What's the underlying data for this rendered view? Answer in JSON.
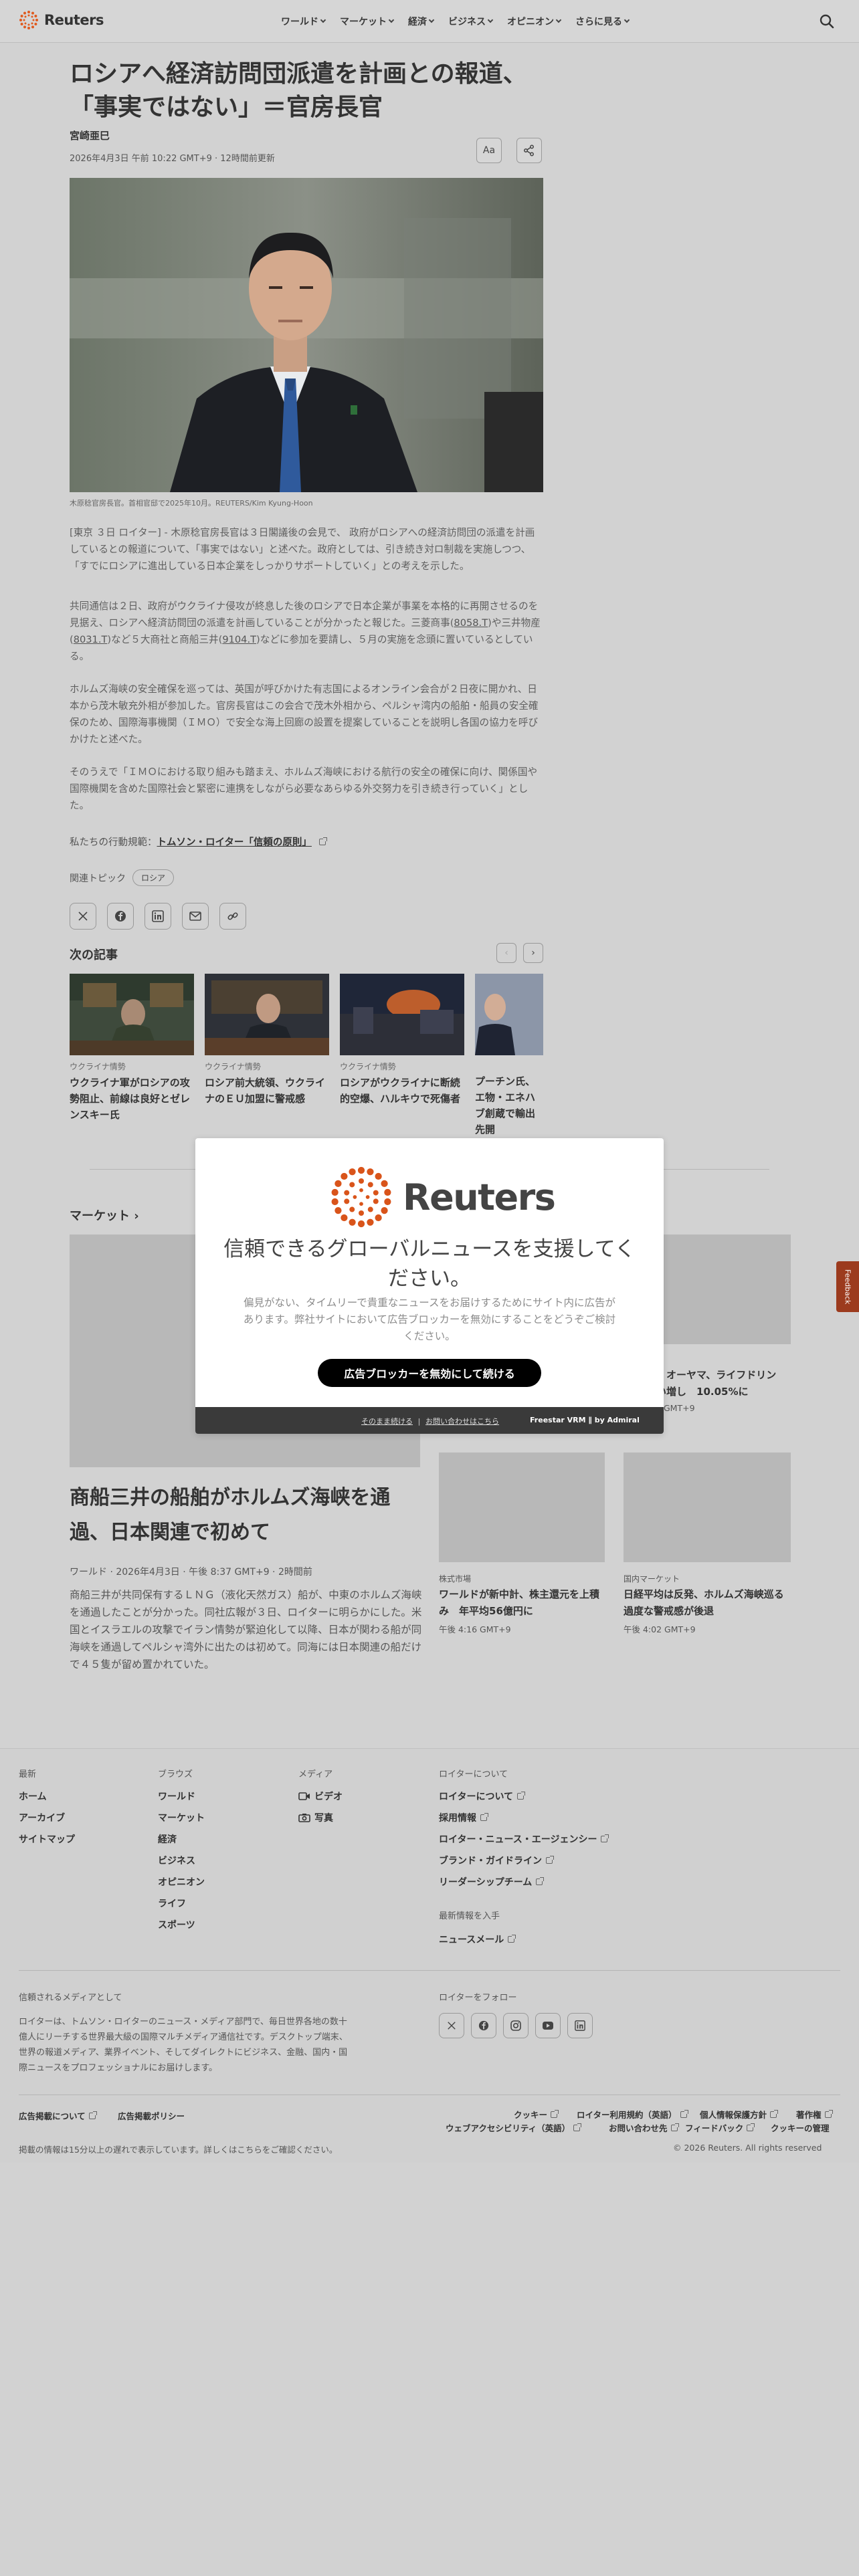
{
  "header": {
    "logo_text": "Reuters",
    "nav": [
      "ワールド",
      "マーケット",
      "経済",
      "ビジネス",
      "オピニオン",
      "さらに見る"
    ]
  },
  "article": {
    "headline": "ロシアへ経済訪問団派遣を計画との報道、「事実ではない」＝官房長官",
    "author": "宮崎亜巳",
    "dateline": "2026年4月3日 午前 10:22 GMT+9 · 12時間前更新",
    "font_button": "Aa",
    "caption": "木原稔官房長官。首相官邸で2025年10月。REUTERS/Kim Kyung-Hoon",
    "p1": "[東京 ３日 ロイター] - 木原稔官房長官は３日閣議後の会見で、 政府がロシアへの経済訪問団の派遣を計画しているとの報道について、「事実ではない」と述べた。政府としては、引き続き対ロ制裁を実施しつつ、「すでにロシアに進出している日本企業をしっかりサポートしていく」との考えを示した。",
    "p2_a": "共同通信は２日、政府がウクライナ侵攻が終息した後のロシアで日本企業が事業を本格的に再開させるのを見据え、ロシアへ経済訪問団の派遣を計画していることが分かったと報じた。三菱商事(",
    "p2_t1": "8058.T",
    "p2_b": ")や三井物産(",
    "p2_t2": "8031.T",
    "p2_c": ")など５大商社と商船三井(",
    "p2_t3": "9104.T",
    "p2_d": ")などに参加を要請し、５月の実施を念頭に置いているとしている。",
    "p3": "ホルムズ海峡の安全確保を巡っては、英国が呼びかけた有志国によるオンライン会合が２日夜に開かれ、日本から茂木敏充外相が参加した。官房長官はこの会合で茂木外相から、ペルシャ湾内の船舶・船員の安全確保のため、国際海事機関（ＩＭＯ）で安全な海上回廊の設置を提案していることを説明し各国の協力を呼びかけたと述べた。",
    "p4": "そのうえで「ＩＭＯにおける取り組みも踏まえ、ホルムズ海峡における航行の安全の確保に向け、関係国や国際機関を含めた国際社会と緊密に連携をしながら必要なあらゆる外交努力を引き続き行っていく」とした。",
    "principles_label": "私たちの行動規範：",
    "principles_link": "トムソン・ロイター「信頼の原則」",
    "topics_label": "関連トピック",
    "topic_pill": "ロシア"
  },
  "next": {
    "title": "次の記事",
    "cards": [
      {
        "kicker": "ウクライナ情勢",
        "title": "ウクライナ軍がロシアの攻勢阻止、前線は良好とゼレンスキー氏"
      },
      {
        "kicker": "ウクライナ情勢",
        "title": "ロシア前大統領、ウクライナのＥＵ加盟に警戒感"
      },
      {
        "kicker": "ウクライナ情勢",
        "title": "ロシアがウクライナに断続的空爆、ハルキウで死傷者"
      },
      {
        "kicker": "",
        "title": "プーチン氏、エ物・エネハブ創蔵で輸出先開"
      }
    ]
  },
  "market": {
    "title": "マーケット",
    "big_headline": "商船三井の船舶がホルムズ海峡を通過、日本関連で初めて",
    "big_meta": "ワールド · 2026年4月3日 · 午後 8:37 GMT+9 · 2時間前",
    "big_body": "商船三井が共同保有するＬＮＧ（液化天然ガス）船が、中東のホルムズ海峡を通過したことが分かった。同社広報が３日、ロイターに明らかにした。米国とイスラエルの攻撃でイラン情勢が緊迫化して以降、日本が関わる船が同海峡を通過してペルシャ湾外に出たのは初めて。同海には日本関連の船だけで４５隻が留め置かれていた。",
    "side_partial_title_1": "ニ、オーヤマ、ライフドリン",
    "side_partial_title_2": "買い増し　10.05%に",
    "side_partial_time": "GMT+9",
    "small": [
      {
        "kicker": "株式市場",
        "title": "ワールドが新中計、株主還元を上積み　年平均56億円に",
        "time": "午後 4:16 GMT+9"
      },
      {
        "kicker": "国内マーケット",
        "title": "日経平均は反発、ホルムズ海峡巡る過度な警戒感が後退",
        "time": "午後 4:02 GMT+9"
      }
    ]
  },
  "feedback": "Feedback",
  "modal": {
    "logo_text": "Reuters",
    "title": "信頼できるグローバルニュースを支援してください。",
    "body": "偏見がない、タイムリーで貴重なニュースをお届けするためにサイト内に広告があります。弊社サイトにおいて広告ブロッカーを無効にすることをどうぞご検討ください。",
    "button": "広告ブロッカーを無効にして続ける",
    "link1": "そのまま続ける",
    "link_sep": "|",
    "link2": "お問い合わせはこちら",
    "brand": "Freestar VRM ∥ by Admiral"
  },
  "footer": {
    "col1_head": "最新",
    "col1": [
      "ホーム",
      "アーカイブ",
      "サイトマップ"
    ],
    "col2_head": "ブラウズ",
    "col2": [
      "ワールド",
      "マーケット",
      "経済",
      "ビジネス",
      "オピニオン",
      "ライフ",
      "スポーツ"
    ],
    "col3_head": "メディア",
    "col3": [
      "ビデオ",
      "写真"
    ],
    "col4_head": "ロイターについて",
    "col4": [
      "ロイターについて",
      "採用情報",
      "ロイター・ニュース・エージェンシー",
      "ブランド・ガイドライン",
      "リーダーシップチーム"
    ],
    "news_head": "最新情報を入手",
    "news_link": "ニュースメール",
    "trust_head": "信頼されるメディアとして",
    "trust_body": "ロイターは、トムソン・ロイターのニュース・メディア部門で、毎日世界各地の数十億人にリーチする世界最大級の国際マルチメディア通信社です。デスクトップ端末、世界の報道メディア、業界イベント、そしてダイレクトにビジネス、金融、国内・国際ニュースをプロフェッショナルにお届けします。",
    "follow_head": "ロイターをフォロー",
    "ads1": "広告掲載について",
    "ads2": "広告掲載ポリシー",
    "legal": [
      "クッキー",
      "ロイター利用規約（英語）",
      "個人情報保護方針",
      "著作権"
    ],
    "legal2": [
      "ウェブアクセシビリティ（英語）",
      "お問い合わせ先",
      "フィードバック",
      "クッキーの管理"
    ],
    "delay": "掲載の情報は15分以上の遅れで表示しています。詳しくはこちらをご確認ください。",
    "copyright": "© 2026 Reuters. All rights reserved"
  }
}
